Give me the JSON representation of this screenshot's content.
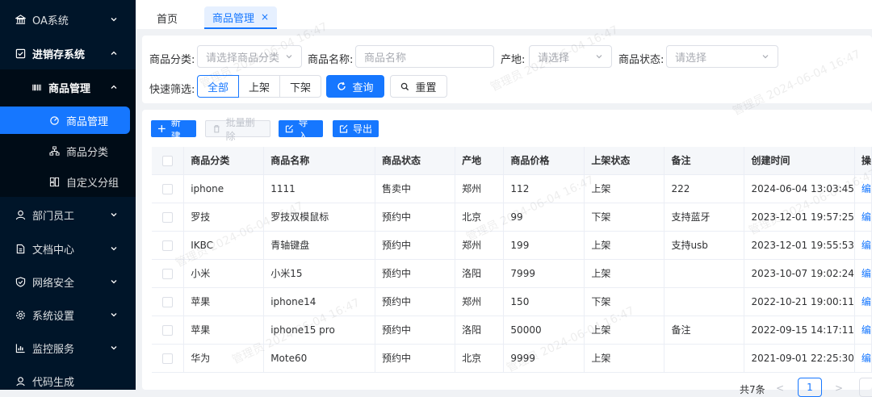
{
  "sidebar": {
    "items": [
      {
        "label": "OA系统",
        "icon": "bank-icon"
      },
      {
        "label": "进销存系统",
        "icon": "inventory-icon"
      },
      {
        "label": "商品管理",
        "icon": "barcode-icon"
      },
      {
        "label": "商品管理",
        "icon": "tag-icon"
      },
      {
        "label": "商品分类",
        "icon": "tree-icon"
      },
      {
        "label": "自定义分组",
        "icon": "group-icon"
      },
      {
        "label": "部门员工",
        "icon": "user-icon"
      },
      {
        "label": "文档中心",
        "icon": "document-icon"
      },
      {
        "label": "网络安全",
        "icon": "shield-icon"
      },
      {
        "label": "系统设置",
        "icon": "gear-icon"
      },
      {
        "label": "监控服务",
        "icon": "chart-icon"
      },
      {
        "label": "代码生成",
        "icon": "code-icon"
      }
    ]
  },
  "tabs": [
    {
      "label": "首页"
    },
    {
      "label": "商品管理",
      "close": "×"
    }
  ],
  "filter": {
    "category_label": "商品分类:",
    "category_placeholder": "请选择商品分类",
    "name_label": "商品名称:",
    "name_placeholder": "商品名称",
    "origin_label": "产地:",
    "origin_placeholder": "请选择",
    "status_label": "商品状态:",
    "status_placeholder": "请选择",
    "quick_label": "快速筛选:",
    "quick_options": [
      "全部",
      "上架",
      "下架"
    ],
    "search_button": "查询",
    "reset_button": "重置"
  },
  "toolbar": {
    "add": "新建",
    "batch_delete": "批量删除",
    "import": "导入",
    "export": "导出"
  },
  "table": {
    "columns": [
      "商品分类",
      "商品名称",
      "商品状态",
      "产地",
      "商品价格",
      "上架状态",
      "备注",
      "创建时间",
      "操"
    ],
    "rows": [
      [
        "iphone",
        "1111",
        "售卖中",
        "郑州",
        "112",
        "上架",
        "222",
        "2024-06-04 13:03:45",
        "编"
      ],
      [
        "罗技",
        "罗技双模鼠标",
        "预约中",
        "北京",
        "99",
        "下架",
        "支持蓝牙",
        "2023-12-01 19:57:25",
        "编"
      ],
      [
        "IKBC",
        "青轴键盘",
        "预约中",
        "郑州",
        "199",
        "上架",
        "支持usb",
        "2023-12-01 19:55:53",
        "编"
      ],
      [
        "小米",
        "小米15",
        "预约中",
        "洛阳",
        "7999",
        "上架",
        "",
        "2023-10-07 19:02:24",
        "编"
      ],
      [
        "苹果",
        "iphone14",
        "预约中",
        "郑州",
        "150",
        "下架",
        "",
        "2022-10-21 19:00:11",
        "编"
      ],
      [
        "苹果",
        "iphone15 pro",
        "预约中",
        "洛阳",
        "50000",
        "上架",
        "备注",
        "2022-09-15 14:17:11",
        "编"
      ],
      [
        "华为",
        "Mote60",
        "预约中",
        "北京",
        "9999",
        "上架",
        "",
        "2021-09-01 22:25:30",
        "编"
      ]
    ]
  },
  "pagination": {
    "total": "共7条",
    "current": "1"
  },
  "watermark": "管理员 2024-06-04 16:47",
  "colors": {
    "primary": "#1677ff",
    "sidebar": "#001529"
  }
}
